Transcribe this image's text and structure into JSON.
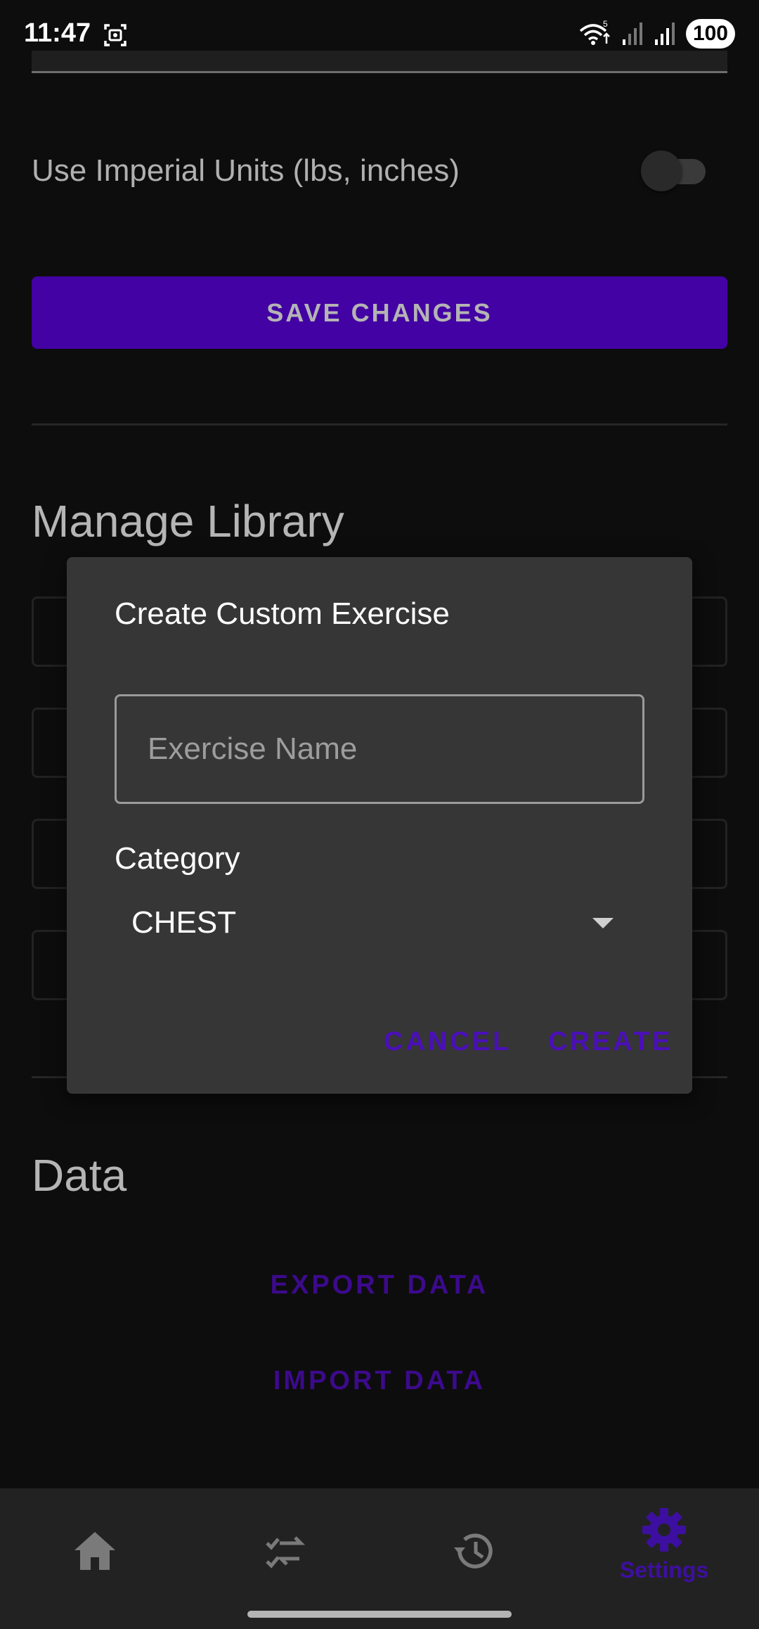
{
  "status_bar": {
    "time": "11:47",
    "battery": "100",
    "icons": [
      "screenshot-icon",
      "wifi-icon",
      "signal-icon",
      "signal-icon",
      "battery-icon"
    ]
  },
  "settings": {
    "imperial_units_label": "Use Imperial Units (lbs, inches)",
    "imperial_units_enabled": false,
    "save_button": "SAVE CHANGES",
    "manage_library_title": "Manage Library",
    "data_title": "Data",
    "export_data": "EXPORT DATA",
    "import_data": "IMPORT DATA"
  },
  "dialog": {
    "title": "Create Custom Exercise",
    "exercise_name_placeholder": "Exercise Name",
    "exercise_name_value": "",
    "category_label": "Category",
    "category_value": "CHEST",
    "cancel_label": "CANCEL",
    "create_label": "CREATE"
  },
  "bottom_nav": {
    "items": [
      {
        "icon": "home-icon",
        "label": ""
      },
      {
        "icon": "swap-icon",
        "label": ""
      },
      {
        "icon": "history-icon",
        "label": ""
      },
      {
        "icon": "settings-gear-icon",
        "label": "Settings"
      }
    ],
    "active_index": 3
  },
  "colors": {
    "accent": "#4302a3",
    "accent_text": "#4a0fb8",
    "background": "#0d0d0d",
    "dialog": "#363636",
    "nav": "#222222"
  }
}
